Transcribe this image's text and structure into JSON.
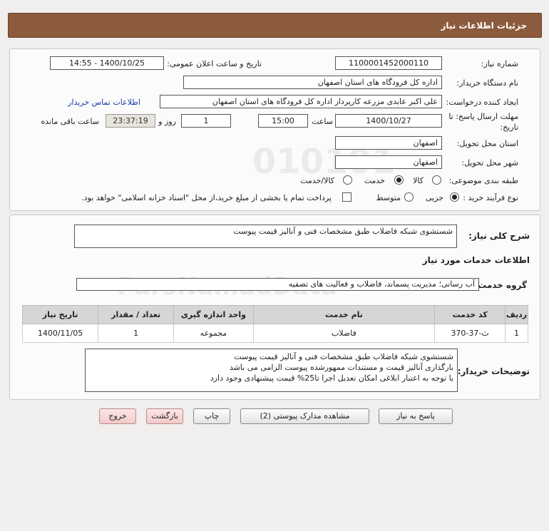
{
  "header": {
    "title": "جزئیات اطلاعات نیاز"
  },
  "info": {
    "need_number_label": "شماره نیاز:",
    "need_number": "1100001452000110",
    "announce_label": "تاریخ و ساعت اعلان عمومی:",
    "announce_value": "1400/10/25 - 14:55",
    "buyer_org_label": "نام دستگاه خریدار:",
    "buyer_org": "اداره کل فرودگاه های استان اصفهان",
    "requester_label": "ایجاد کننده درخواست:",
    "requester": "علی اکبر عابدی مزرعه کارپرداز اداره کل فرودگاه های استان اصفهان",
    "contact_link": "اطلاعات تماس خریدار",
    "deadline_label_1": "مهلت ارسال پاسخ: تا",
    "deadline_label_2": "تاریخ:",
    "deadline_date": "1400/10/27",
    "time_label": "ساعت",
    "deadline_time": "15:00",
    "days_value": "1",
    "days_label": "روز و",
    "remaining_time": "23:37:19",
    "remaining_label": "ساعت باقی مانده",
    "province_label": "استان محل تحویل:",
    "province": "اصفهان",
    "city_label": "شهر محل تحویل:",
    "city": "اصفهان",
    "category_label": "طبقه بندی موضوعی:",
    "category_options": [
      "کالا",
      "خدمت",
      "کالا/خدمت"
    ],
    "category_selected": "خدمت",
    "process_label": "نوع فرآیند خرید :",
    "process_options": [
      "جزیی",
      "متوسط"
    ],
    "process_selected": "جزیی",
    "payment_note": "پرداخت تمام یا بخشی از مبلغ خرید،از محل \"اسناد خزانه اسلامی\" خواهد بود."
  },
  "summary": {
    "general_desc_label": "شرح کلی نیاز:",
    "general_desc": "شستشوی شبکه فاضلاب طبق مشخصات فنی و آنالیز قیمت پیوست",
    "services_title": "اطلاعات خدمات مورد نیاز",
    "service_group_label": "گروه خدمت:",
    "service_group": "آب رسانی؛ مدیریت پسماند، فاضلاب و فعالیت های تصفیه",
    "table": {
      "headers": [
        "ردیف",
        "کد خدمت",
        "نام خدمت",
        "واحد اندازه گیری",
        "تعداد / مقدار",
        "تاریخ نیاز"
      ],
      "rows": [
        [
          "1",
          "ث-37-370",
          "فاضلاب",
          "مجموعه",
          "1",
          "1400/11/05"
        ]
      ]
    },
    "buyer_notes_label": "توضیحات خریدار:",
    "buyer_notes": [
      "شستشوی شبکه فاضلاب طبق مشخصات فنی و آنالیز قیمت پیوست",
      "بارگذاری آنالیز قیمت و مستندات ممهورشده پیوست الزامی می باشد",
      "با توجه به اعتبار ابلاغی امکان تعدیل اجرا تا25% قیمت پیشنهادی وجود دارد"
    ]
  },
  "buttons": {
    "reply": "پاسخ به نیاز",
    "view_attachments": "مشاهده مدارک پیوستی (2)",
    "print": "چاپ",
    "back": "بازگشت",
    "exit": "خروج"
  },
  "colors": {
    "header_bg": "#8c5a3c",
    "link": "#1a3ea8",
    "pink_button": "#f2caca"
  }
}
